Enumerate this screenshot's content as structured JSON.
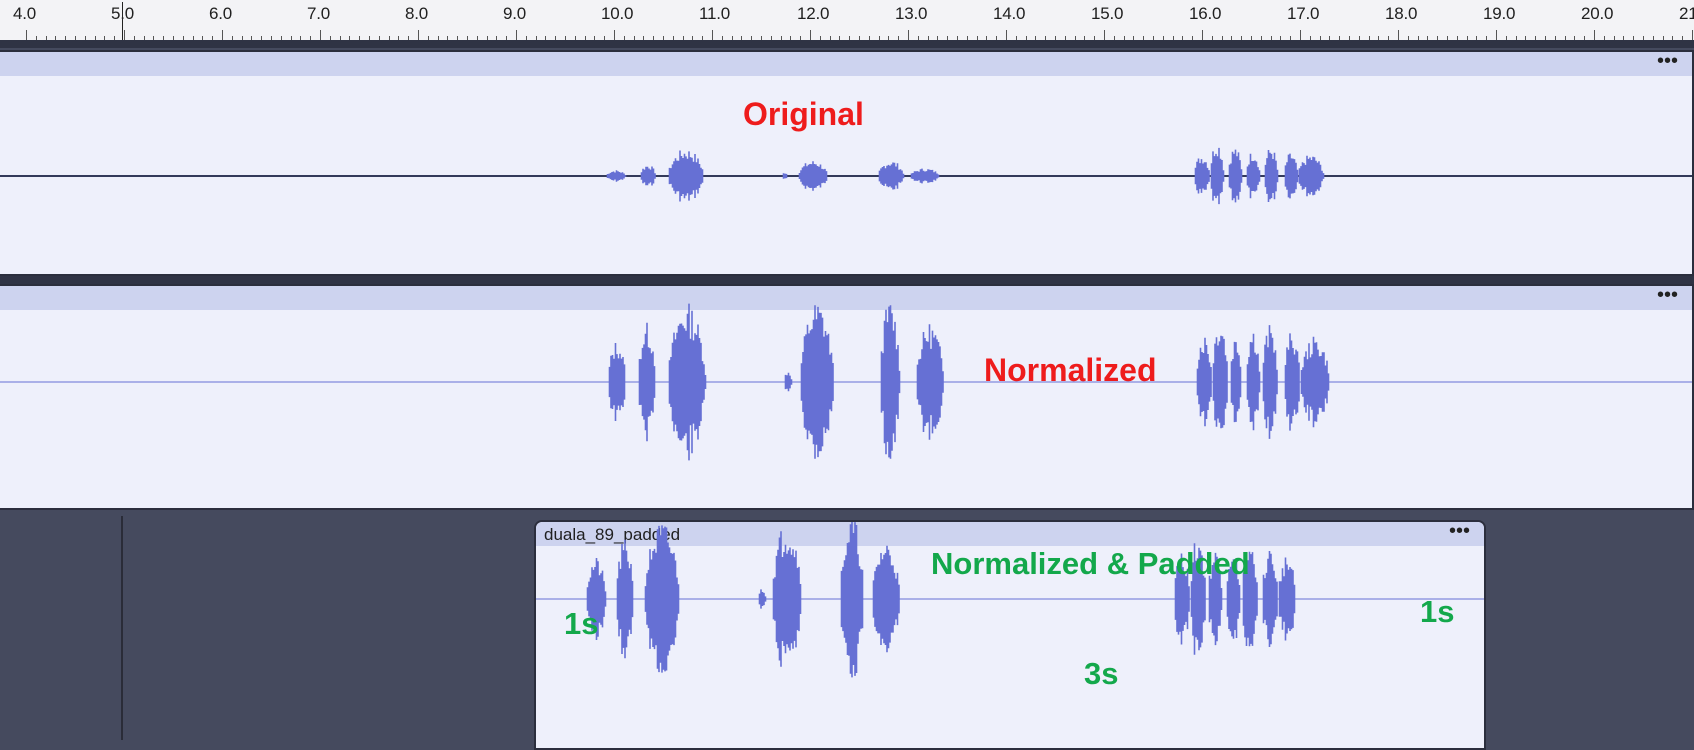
{
  "ruler": {
    "ticks": [
      {
        "label": "4.0",
        "value": 4.0
      },
      {
        "label": "5.0",
        "value": 5.0
      },
      {
        "label": "6.0",
        "value": 6.0
      },
      {
        "label": "7.0",
        "value": 7.0
      },
      {
        "label": "8.0",
        "value": 8.0
      },
      {
        "label": "9.0",
        "value": 9.0
      },
      {
        "label": "10.0",
        "value": 10.0
      },
      {
        "label": "11.0",
        "value": 11.0
      },
      {
        "label": "12.0",
        "value": 12.0
      },
      {
        "label": "13.0",
        "value": 13.0
      },
      {
        "label": "14.0",
        "value": 14.0
      },
      {
        "label": "15.0",
        "value": 15.0
      },
      {
        "label": "16.0",
        "value": 16.0
      },
      {
        "label": "17.0",
        "value": 17.0
      },
      {
        "label": "18.0",
        "value": 18.0
      },
      {
        "label": "19.0",
        "value": 19.0
      },
      {
        "label": "20.0",
        "value": 20.0
      },
      {
        "label": "21.",
        "value": 21.0
      }
    ]
  },
  "tracks": [
    {
      "name": "",
      "menu": "•••",
      "annotation": "Original"
    },
    {
      "name": "",
      "menu": "•••",
      "annotation": "Normalized"
    },
    {
      "name": "duala_89_padded",
      "menu": "•••",
      "annotation": "Normalized & Padded"
    }
  ],
  "padding_labels": {
    "leading": "1s",
    "gap": "3s",
    "trailing": "1s"
  },
  "colors": {
    "waveform": "#6670d4",
    "clip_background": "#eef0fb",
    "clip_header": "#cdd3ef",
    "timeline_background": "#454a5e",
    "annotation_red": "#ee1c1c",
    "annotation_green": "#13a84b"
  }
}
